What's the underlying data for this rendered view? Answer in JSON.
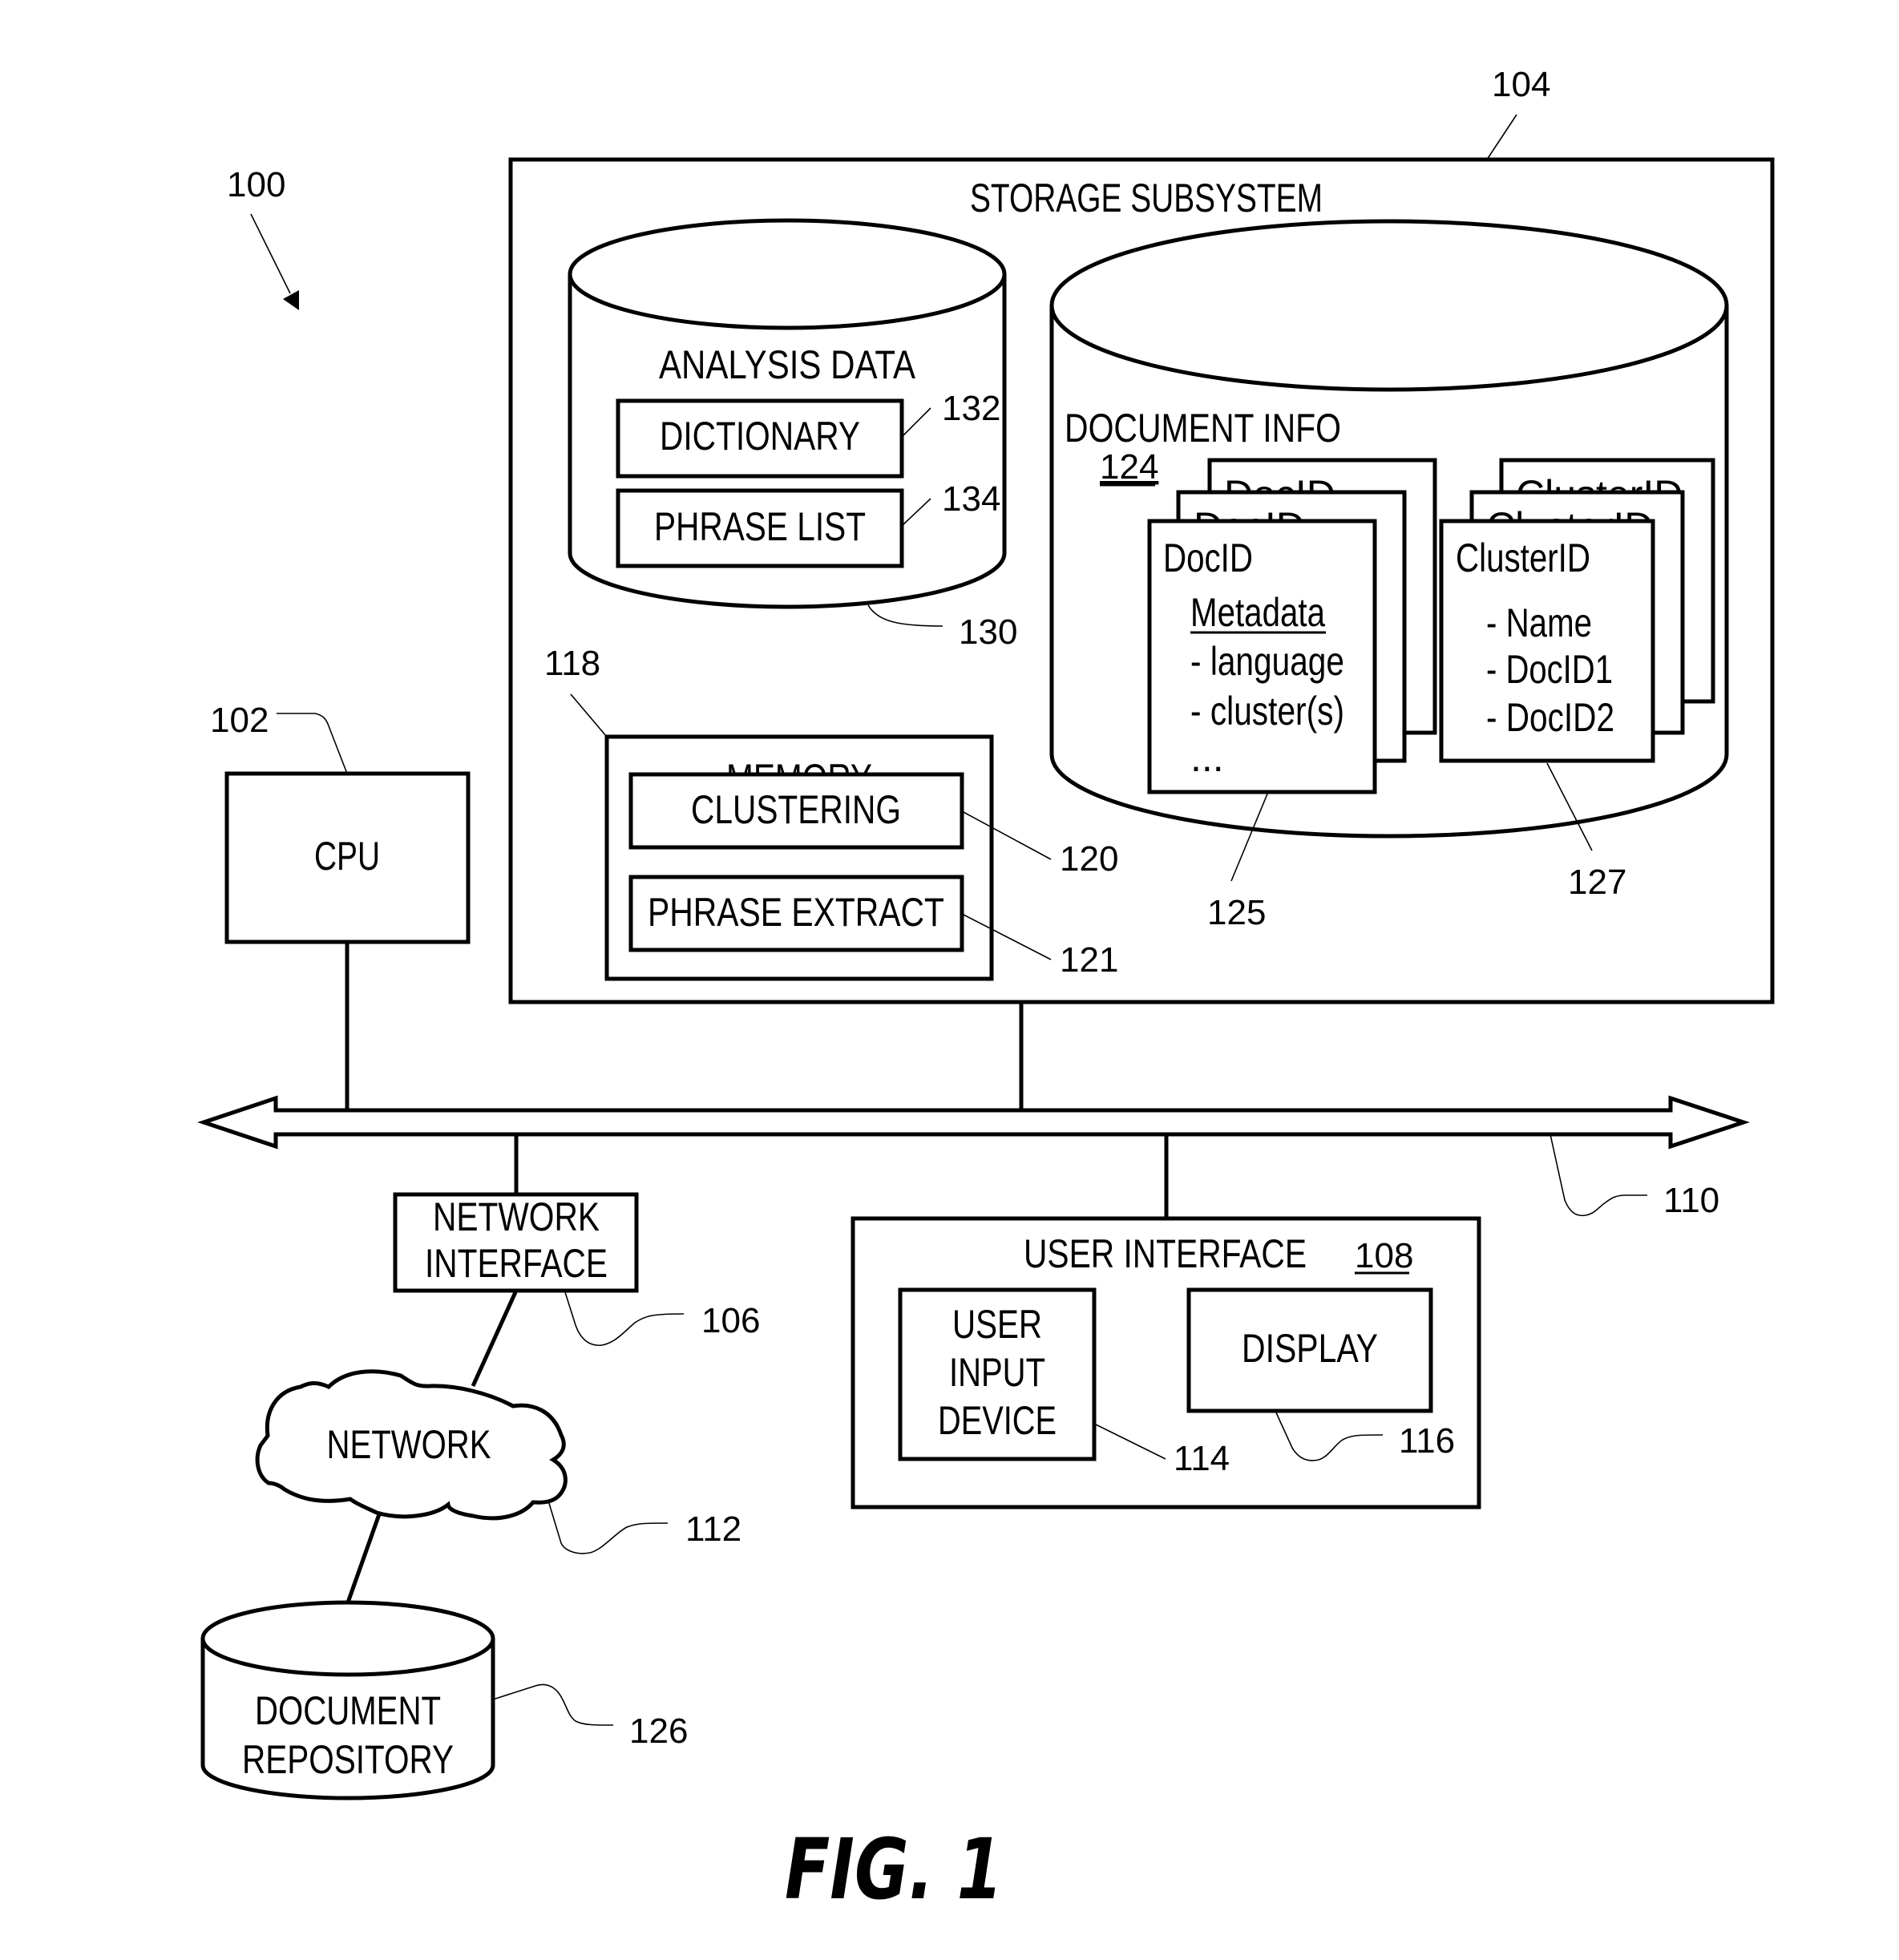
{
  "figure": {
    "caption": "FIG. 1",
    "system_ref": "100"
  },
  "cpu": {
    "label": "CPU",
    "ref": "102"
  },
  "storage_subsystem": {
    "label": "STORAGE SUBSYSTEM",
    "ref": "104",
    "analysis_data": {
      "label": "ANALYSIS DATA",
      "ref": "130",
      "dictionary": {
        "label": "DICTIONARY",
        "ref": "132"
      },
      "phrase_list": {
        "label": "PHRASE LIST",
        "ref": "134"
      }
    },
    "memory": {
      "label": "MEMORY",
      "ref": "118",
      "clustering": {
        "label": "CLUSTERING",
        "ref": "120"
      },
      "phrase_extract": {
        "label": "PHRASE EXTRACT",
        "ref": "121"
      }
    },
    "document_info": {
      "label": "DOCUMENT INFO",
      "ref": "124",
      "doc_record": {
        "ref": "125",
        "title": "DocID",
        "section": "Metadata",
        "items": [
          "- language",
          "- cluster(s)",
          "..."
        ]
      },
      "cluster_record": {
        "ref": "127",
        "title": "ClusterID",
        "items": [
          "- Name",
          "- DocID1",
          "- DocID2"
        ]
      }
    }
  },
  "bus": {
    "ref": "110"
  },
  "network_interface": {
    "line1": "NETWORK",
    "line2": "INTERFACE",
    "ref": "106"
  },
  "network": {
    "label": "NETWORK",
    "ref": "112"
  },
  "document_repository": {
    "line1": "DOCUMENT",
    "line2": "REPOSITORY",
    "ref": "126"
  },
  "user_interface": {
    "label": "USER INTERFACE",
    "ref": "108",
    "user_input_device": {
      "line1": "USER",
      "line2": "INPUT",
      "line3": "DEVICE",
      "ref": "114"
    },
    "display": {
      "label": "DISPLAY",
      "ref": "116"
    }
  },
  "colors": {
    "ink": "#000000",
    "paper": "#ffffff"
  }
}
